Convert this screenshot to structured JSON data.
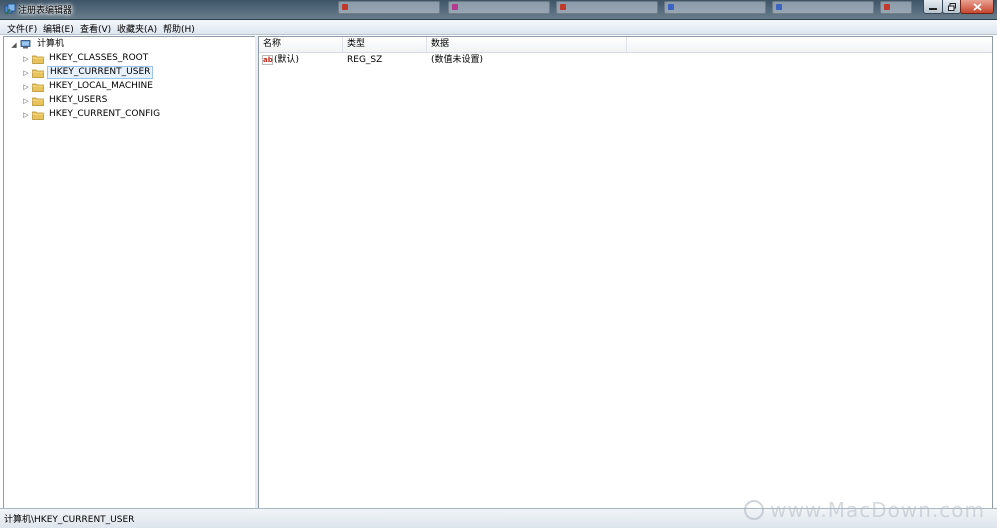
{
  "window": {
    "title": "注册表编辑器"
  },
  "menu": {
    "items": [
      "文件(F)",
      "编辑(E)",
      "查看(V)",
      "收藏夹(A)",
      "帮助(H)"
    ]
  },
  "tree": {
    "root": "计算机",
    "children": [
      {
        "label": "HKEY_CLASSES_ROOT",
        "selected": false
      },
      {
        "label": "HKEY_CURRENT_USER",
        "selected": true
      },
      {
        "label": "HKEY_LOCAL_MACHINE",
        "selected": false
      },
      {
        "label": "HKEY_USERS",
        "selected": false
      },
      {
        "label": "HKEY_CURRENT_CONFIG",
        "selected": false
      }
    ]
  },
  "list": {
    "columns": [
      "名称",
      "类型",
      "数据"
    ],
    "rows": [
      {
        "name": "(默认)",
        "type": "REG_SZ",
        "data": "(数值未设置)"
      }
    ]
  },
  "status": {
    "path": "计算机\\HKEY_CURRENT_USER"
  },
  "watermark": {
    "text": "www.MacDown.com"
  },
  "colors": {
    "selection_bg": "#e6f1fb",
    "selection_border": "#9dc4e8",
    "folder": "#e8c25a"
  }
}
